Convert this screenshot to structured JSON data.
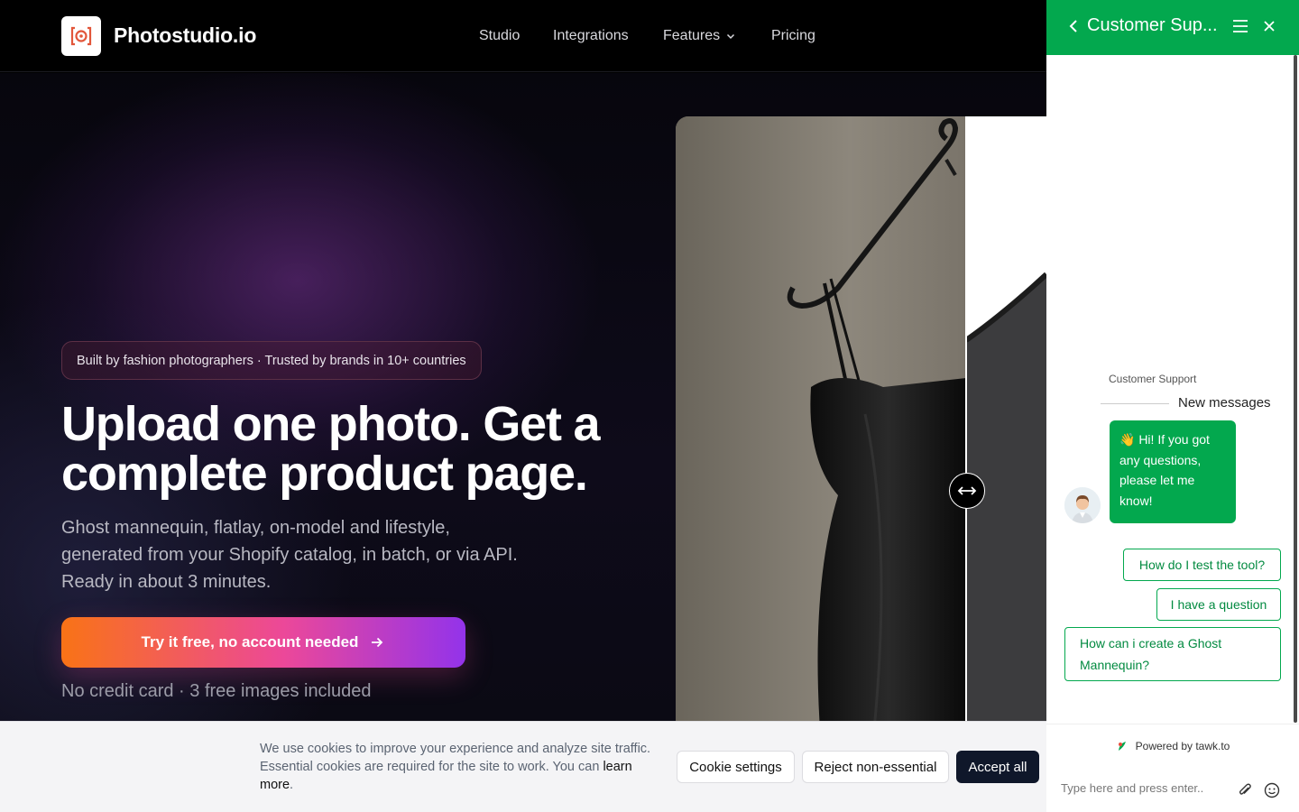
{
  "header": {
    "brand": "Photostudio.io",
    "nav": [
      {
        "label": "Studio"
      },
      {
        "label": "Integrations"
      },
      {
        "label": "Features"
      },
      {
        "label": "Pricing"
      }
    ]
  },
  "hero": {
    "badge": "Built by fashion photographers · Trusted by brands in 10+ countries",
    "title_line1": "Upload one photo. Get a",
    "title_line2": "complete product page.",
    "subtitle_line1": "Ghost mannequin, flatlay, on-model and lifestyle,",
    "subtitle_line2": "generated from your Shopify catalog, in batch, or via API.",
    "subtitle_line3": "Ready in about 3 minutes.",
    "cta_label": "Try it free, no account needed",
    "cta_note": "No credit card · 3 free images included"
  },
  "cookie": {
    "text": "We use cookies to improve your experience and analyze site traffic. Essential cookies are required for the site to work. You can",
    "link": "learn more",
    "period": ".",
    "settings_label": "Cookie settings",
    "reject_label": "Reject non-essential",
    "accept_label": "Accept all"
  },
  "chat": {
    "title": "Customer Sup...",
    "agent_name": "Customer Support",
    "new_messages": "New messages",
    "message": "👋 Hi! If you got any questions, please let me know!",
    "quick_replies": [
      {
        "label": "How do I test the tool?"
      },
      {
        "label": "I have a question"
      },
      {
        "label": "How can i create a Ghost Mannequin?"
      }
    ],
    "powered_by": "Powered by tawk.to",
    "input_placeholder": "Type here and press enter..",
    "header_color": "#03a84e"
  },
  "colors": {
    "cta_gradient": [
      "#f97316",
      "#ec4899",
      "#9333ea"
    ],
    "accept_button": "#0f172a"
  }
}
